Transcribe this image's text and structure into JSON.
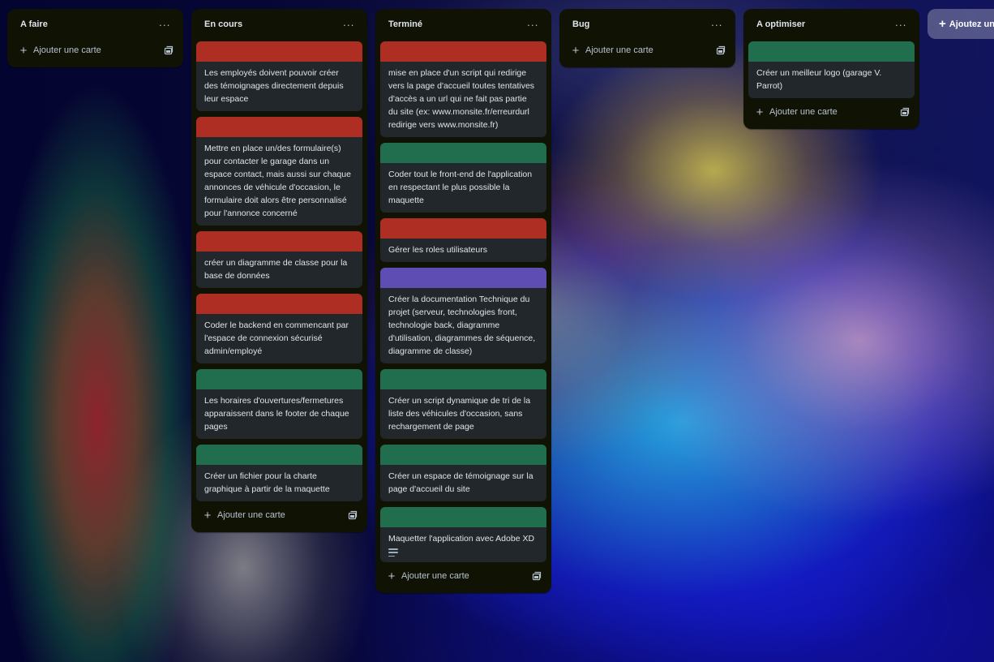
{
  "colors": {
    "label_red": "#ae2e24",
    "label_green": "#216e4e",
    "label_purple": "#5e4db2",
    "list_bg": "#101204",
    "card_bg": "#22272b"
  },
  "lists": [
    {
      "title": "A faire",
      "menu": "···",
      "add_label": "Ajouter une carte",
      "cards": []
    },
    {
      "title": "En cours",
      "menu": "···",
      "add_label": "Ajouter une carte",
      "cards": [
        {
          "cover": "red",
          "text": "Les employés doivent pouvoir créer des témoignages directement depuis leur espace"
        },
        {
          "cover": "red",
          "text": "Mettre en place un/des formulaire(s) pour contacter le garage dans un espace contact, mais aussi sur chaque annonces de véhicule d'occasion, le formulaire doit alors être personnalisé pour l'annonce concerné"
        },
        {
          "cover": "red",
          "text": "créer un diagramme de classe pour la base de données"
        },
        {
          "cover": "red",
          "text": "Coder le backend en commencant par l'espace de connexion sécurisé admin/employé"
        },
        {
          "cover": "green",
          "text": "Les horaires d'ouvertures/fermetures apparaissent dans le footer de chaque pages"
        },
        {
          "cover": "green",
          "text": "Créer un fichier pour la charte graphique à partir de la maquette"
        }
      ]
    },
    {
      "title": "Terminé",
      "menu": "···",
      "add_label": "Ajouter une carte",
      "cards": [
        {
          "cover": "red",
          "text": "mise en place d'un script qui redirige vers la page d'accueil toutes tentatives d'accès a un url qui ne fait pas partie du site (ex: www.monsite.fr/erreurdurl redirige vers www.monsite.fr)"
        },
        {
          "cover": "green",
          "text": "Coder tout le front-end de l'application en respectant le plus possible la maquette"
        },
        {
          "cover": "red",
          "text": "Gérer les roles utilisateurs"
        },
        {
          "cover": "purple",
          "text": "Créer la documentation Technique du projet (serveur, technologies front, technologie back, diagramme d'utilisation, diagrammes de séquence, diagramme de classe)"
        },
        {
          "cover": "green",
          "text": "Créer un script dynamique de tri de la liste des véhicules d'occasion, sans rechargement de page"
        },
        {
          "cover": "green",
          "text": "Créer un espace de témoignage sur la page d'accueil du site"
        },
        {
          "cover": "green",
          "text": "Maquetter l'application avec Adobe XD",
          "badge": "description-icon"
        }
      ]
    },
    {
      "title": "Bug",
      "menu": "···",
      "add_label": "Ajouter une carte",
      "cards": []
    },
    {
      "title": "A optimiser",
      "menu": "···",
      "add_label": "Ajouter une carte",
      "cards": [
        {
          "cover": "green",
          "text": "Créer un meilleur logo (garage V. Parrot)"
        }
      ]
    }
  ],
  "add_list_label": "Ajoutez une autre liste"
}
